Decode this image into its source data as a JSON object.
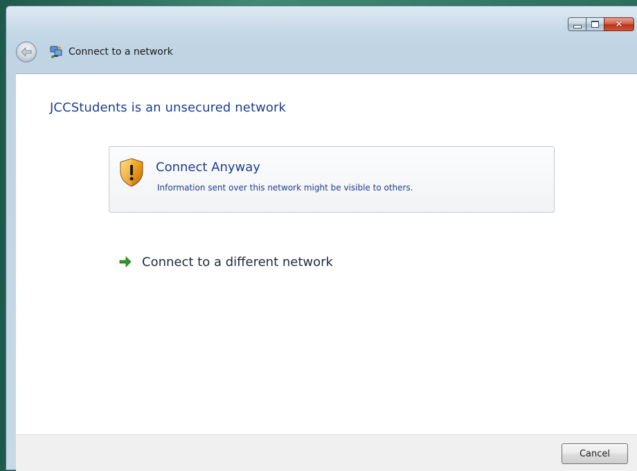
{
  "window": {
    "title": "Connect to a network",
    "caption_buttons": {
      "minimize_icon": "minimize-icon",
      "maximize_icon": "maximize-icon",
      "close_icon": "close-icon",
      "close_glyph": "✕"
    },
    "back_icon": "back-arrow-icon",
    "app_icon": "network-icon"
  },
  "main": {
    "heading": "JCCStudents is an unsecured network",
    "connect_anyway": {
      "title": "Connect Anyway",
      "description": "Information sent over this network might be visible to others.",
      "icon": "security-shield-icon"
    },
    "different_network": {
      "label": "Connect to a different network",
      "icon": "green-arrow-icon"
    }
  },
  "footer": {
    "cancel_label": "Cancel"
  },
  "colors": {
    "link_blue": "#1b3d8f",
    "arrow_green": "#2d9a1f",
    "shield_orange": "#e8901c",
    "close_red": "#c23a22"
  }
}
